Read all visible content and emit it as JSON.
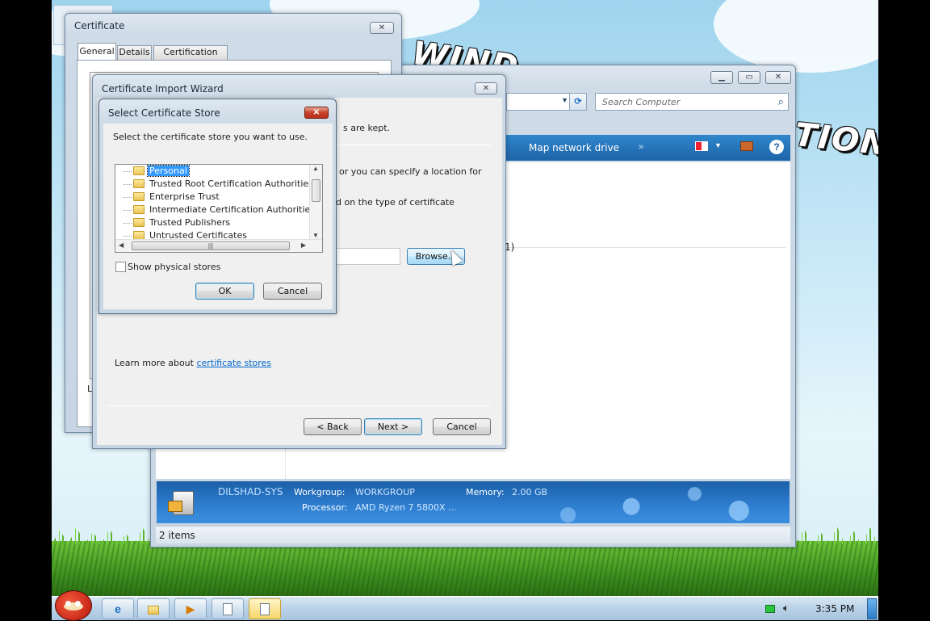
{
  "wallpaper": {
    "text_top": "WIND",
    "text_right": "TION"
  },
  "taskbar": {
    "time": "3:35 PM",
    "items": [
      "ie-icon",
      "folder-icon",
      "media-player-icon",
      "document-icon",
      "document-icon"
    ]
  },
  "explorer": {
    "search_placeholder": "Search Computer",
    "toolbar": {
      "map_drive": "Map network drive"
    },
    "content_fragment": "1)",
    "banner": {
      "computer_name": "DILSHAD-SYS",
      "workgroup_label": "Workgroup:",
      "workgroup_value": "WORKGROUP",
      "memory_label": "Memory:",
      "memory_value": "2.00 GB",
      "processor_label": "Processor:",
      "processor_value": "AMD Ryzen 7 5800X ..."
    },
    "status": "2 items"
  },
  "certificate": {
    "title": "Certificate",
    "tabs": [
      "General",
      "Details",
      "Certification Path"
    ],
    "bottom_fragment": "Le"
  },
  "wizard": {
    "title": "Certificate Import Wizard",
    "text_line1": "s are kept.",
    "text_line2": "or you can specify a location for",
    "text_line3": "d on the type of certificate",
    "browse": "Browse...",
    "learn_more_prefix": "Learn more about ",
    "learn_more_link": "certificate stores",
    "back": "< Back",
    "next": "Next >",
    "cancel": "Cancel"
  },
  "store_dialog": {
    "title": "Select Certificate Store",
    "instruction": "Select the certificate store you want to use.",
    "stores": [
      "Personal",
      "Trusted Root Certification Authorities",
      "Enterprise Trust",
      "Intermediate Certification Authorities",
      "Trusted Publishers",
      "Untrusted Certificates"
    ],
    "selected_index": 0,
    "show_physical": "Show physical stores",
    "ok": "OK",
    "cancel": "Cancel"
  },
  "colors": {
    "accent": "#3399ff",
    "link": "#0066cc",
    "banner": "#2f7fd1"
  }
}
